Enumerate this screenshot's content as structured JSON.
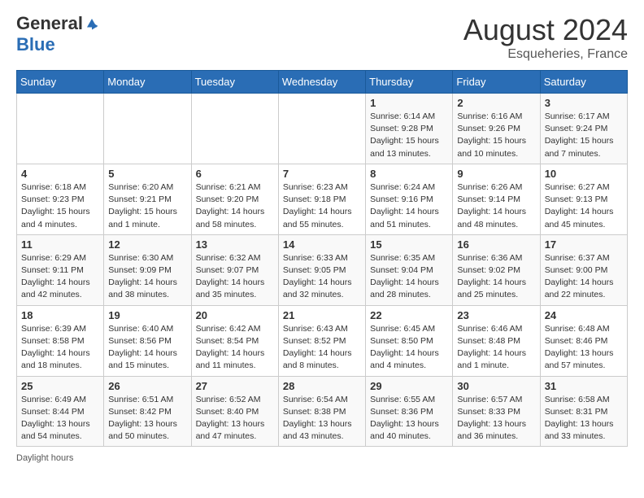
{
  "header": {
    "logo_general": "General",
    "logo_blue": "Blue",
    "month_year": "August 2024",
    "location": "Esqueheries, France"
  },
  "footer": {
    "note": "Daylight hours"
  },
  "days_of_week": [
    "Sunday",
    "Monday",
    "Tuesday",
    "Wednesday",
    "Thursday",
    "Friday",
    "Saturday"
  ],
  "weeks": [
    [
      {
        "day": "",
        "info": ""
      },
      {
        "day": "",
        "info": ""
      },
      {
        "day": "",
        "info": ""
      },
      {
        "day": "",
        "info": ""
      },
      {
        "day": "1",
        "info": "Sunrise: 6:14 AM\nSunset: 9:28 PM\nDaylight: 15 hours\nand 13 minutes."
      },
      {
        "day": "2",
        "info": "Sunrise: 6:16 AM\nSunset: 9:26 PM\nDaylight: 15 hours\nand 10 minutes."
      },
      {
        "day": "3",
        "info": "Sunrise: 6:17 AM\nSunset: 9:24 PM\nDaylight: 15 hours\nand 7 minutes."
      }
    ],
    [
      {
        "day": "4",
        "info": "Sunrise: 6:18 AM\nSunset: 9:23 PM\nDaylight: 15 hours\nand 4 minutes."
      },
      {
        "day": "5",
        "info": "Sunrise: 6:20 AM\nSunset: 9:21 PM\nDaylight: 15 hours\nand 1 minute."
      },
      {
        "day": "6",
        "info": "Sunrise: 6:21 AM\nSunset: 9:20 PM\nDaylight: 14 hours\nand 58 minutes."
      },
      {
        "day": "7",
        "info": "Sunrise: 6:23 AM\nSunset: 9:18 PM\nDaylight: 14 hours\nand 55 minutes."
      },
      {
        "day": "8",
        "info": "Sunrise: 6:24 AM\nSunset: 9:16 PM\nDaylight: 14 hours\nand 51 minutes."
      },
      {
        "day": "9",
        "info": "Sunrise: 6:26 AM\nSunset: 9:14 PM\nDaylight: 14 hours\nand 48 minutes."
      },
      {
        "day": "10",
        "info": "Sunrise: 6:27 AM\nSunset: 9:13 PM\nDaylight: 14 hours\nand 45 minutes."
      }
    ],
    [
      {
        "day": "11",
        "info": "Sunrise: 6:29 AM\nSunset: 9:11 PM\nDaylight: 14 hours\nand 42 minutes."
      },
      {
        "day": "12",
        "info": "Sunrise: 6:30 AM\nSunset: 9:09 PM\nDaylight: 14 hours\nand 38 minutes."
      },
      {
        "day": "13",
        "info": "Sunrise: 6:32 AM\nSunset: 9:07 PM\nDaylight: 14 hours\nand 35 minutes."
      },
      {
        "day": "14",
        "info": "Sunrise: 6:33 AM\nSunset: 9:05 PM\nDaylight: 14 hours\nand 32 minutes."
      },
      {
        "day": "15",
        "info": "Sunrise: 6:35 AM\nSunset: 9:04 PM\nDaylight: 14 hours\nand 28 minutes."
      },
      {
        "day": "16",
        "info": "Sunrise: 6:36 AM\nSunset: 9:02 PM\nDaylight: 14 hours\nand 25 minutes."
      },
      {
        "day": "17",
        "info": "Sunrise: 6:37 AM\nSunset: 9:00 PM\nDaylight: 14 hours\nand 22 minutes."
      }
    ],
    [
      {
        "day": "18",
        "info": "Sunrise: 6:39 AM\nSunset: 8:58 PM\nDaylight: 14 hours\nand 18 minutes."
      },
      {
        "day": "19",
        "info": "Sunrise: 6:40 AM\nSunset: 8:56 PM\nDaylight: 14 hours\nand 15 minutes."
      },
      {
        "day": "20",
        "info": "Sunrise: 6:42 AM\nSunset: 8:54 PM\nDaylight: 14 hours\nand 11 minutes."
      },
      {
        "day": "21",
        "info": "Sunrise: 6:43 AM\nSunset: 8:52 PM\nDaylight: 14 hours\nand 8 minutes."
      },
      {
        "day": "22",
        "info": "Sunrise: 6:45 AM\nSunset: 8:50 PM\nDaylight: 14 hours\nand 4 minutes."
      },
      {
        "day": "23",
        "info": "Sunrise: 6:46 AM\nSunset: 8:48 PM\nDaylight: 14 hours\nand 1 minute."
      },
      {
        "day": "24",
        "info": "Sunrise: 6:48 AM\nSunset: 8:46 PM\nDaylight: 13 hours\nand 57 minutes."
      }
    ],
    [
      {
        "day": "25",
        "info": "Sunrise: 6:49 AM\nSunset: 8:44 PM\nDaylight: 13 hours\nand 54 minutes."
      },
      {
        "day": "26",
        "info": "Sunrise: 6:51 AM\nSunset: 8:42 PM\nDaylight: 13 hours\nand 50 minutes."
      },
      {
        "day": "27",
        "info": "Sunrise: 6:52 AM\nSunset: 8:40 PM\nDaylight: 13 hours\nand 47 minutes."
      },
      {
        "day": "28",
        "info": "Sunrise: 6:54 AM\nSunset: 8:38 PM\nDaylight: 13 hours\nand 43 minutes."
      },
      {
        "day": "29",
        "info": "Sunrise: 6:55 AM\nSunset: 8:36 PM\nDaylight: 13 hours\nand 40 minutes."
      },
      {
        "day": "30",
        "info": "Sunrise: 6:57 AM\nSunset: 8:33 PM\nDaylight: 13 hours\nand 36 minutes."
      },
      {
        "day": "31",
        "info": "Sunrise: 6:58 AM\nSunset: 8:31 PM\nDaylight: 13 hours\nand 33 minutes."
      }
    ]
  ]
}
